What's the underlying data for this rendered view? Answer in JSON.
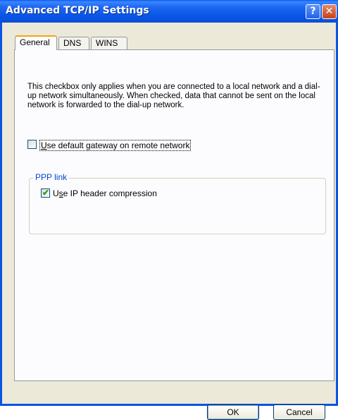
{
  "window": {
    "title": "Advanced TCP/IP Settings",
    "help_glyph": "?",
    "close_glyph": "✕"
  },
  "tabs": [
    {
      "label": "General",
      "active": true
    },
    {
      "label": "DNS",
      "active": false
    },
    {
      "label": "WINS",
      "active": false
    }
  ],
  "general": {
    "description": "This checkbox only applies when you are connected to a local network and a dial-up network simultaneously.  When checked, data that cannot be sent on the local network is forwarded to the dial-up network.",
    "default_gateway": {
      "checked": false,
      "label_access_key": "U",
      "label_rest": "se default gateway on remote network"
    },
    "ppp_group": {
      "label": "PPP link",
      "ip_header_compression": {
        "checked": true,
        "label_prefix": "U",
        "label_access_key": "s",
        "label_rest": "e IP header compression"
      }
    }
  },
  "buttons": {
    "ok": "OK",
    "cancel": "Cancel"
  }
}
